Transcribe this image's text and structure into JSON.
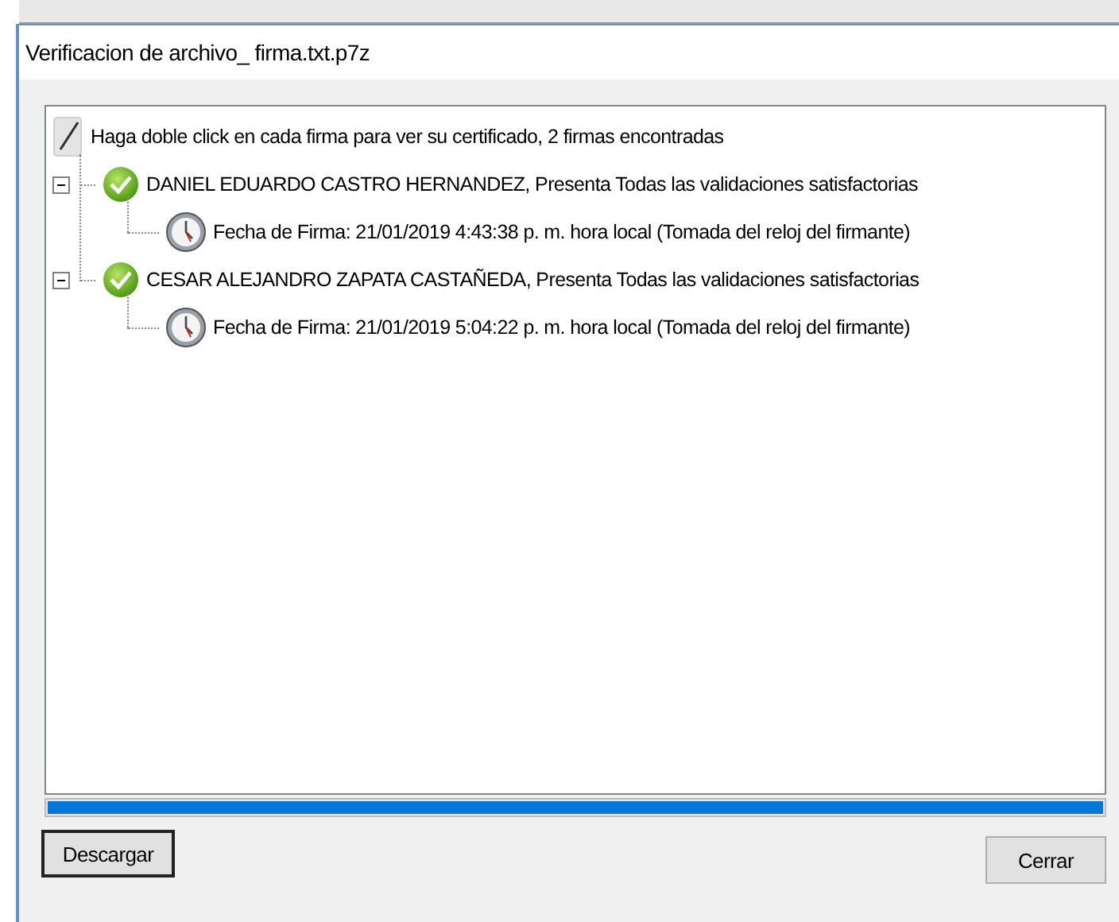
{
  "window": {
    "title": "Verificacion de archivo_ firma.txt.p7z"
  },
  "tree": {
    "root": {
      "kind": "note",
      "text": "Haga doble click en cada firma para ver su certificado, 2 firmas encontradas",
      "children": [
        {
          "kind": "signer",
          "text": "DANIEL EDUARDO CASTRO HERNANDEZ, Presenta Todas las validaciones satisfactorias",
          "expanded": true,
          "children": [
            {
              "kind": "date",
              "text": "Fecha de Firma: 21/01/2019 4:43:38 p. m. hora local (Tomada del reloj del firmante)"
            }
          ]
        },
        {
          "kind": "signer",
          "text": "CESAR ALEJANDRO ZAPATA CASTAÑEDA, Presenta Todas las validaciones satisfactorias",
          "expanded": true,
          "children": [
            {
              "kind": "date",
              "text": "Fecha de Firma: 21/01/2019 5:04:22 p. m. hora local (Tomada del reloj del firmante)"
            }
          ]
        }
      ]
    }
  },
  "progress": {
    "level": 1
  },
  "buttons": [
    {
      "label": "Descargar",
      "kind": "default"
    },
    {
      "label": "Cerrar",
      "kind": "normal"
    }
  ]
}
